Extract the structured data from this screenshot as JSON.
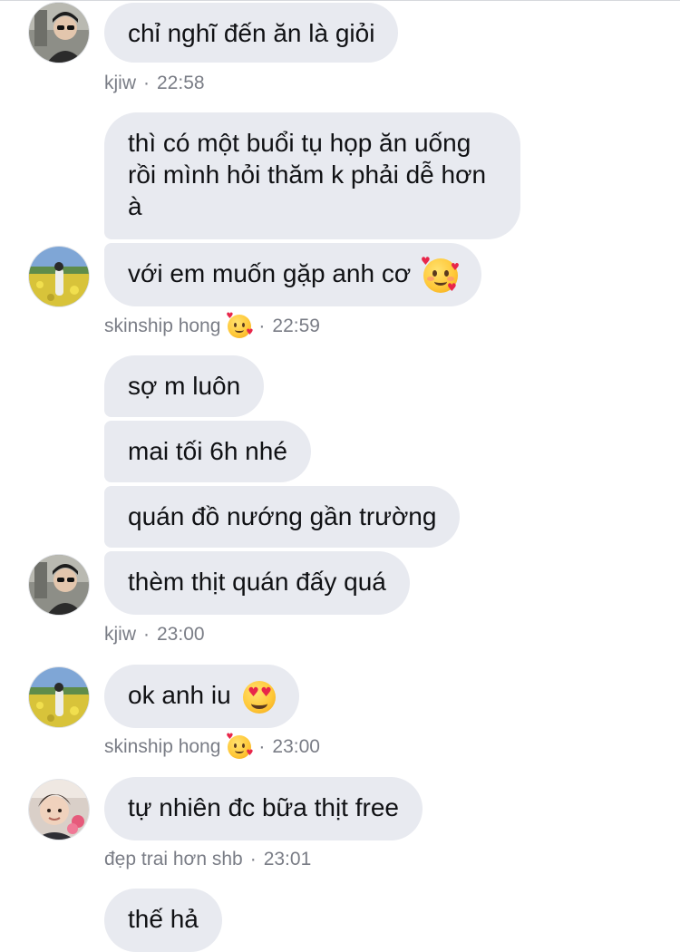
{
  "users": {
    "kjiw": "kjiw",
    "skinship": "skinship hong",
    "deptrai": "đẹp trai hơn shb"
  },
  "icons": {
    "smiling_hearts": "smiling-face-with-hearts-emoji",
    "heart_eyes": "heart-eyes-emoji"
  },
  "messages": {
    "m1": "chỉ nghĩ đến ăn là giỏi",
    "m2": "thì có một buổi tụ họp ăn uống rồi mình hỏi thăm k phải dễ hơn à",
    "m3": "với em muốn gặp anh cơ",
    "m4": "sợ m luôn",
    "m5": "mai tối 6h nhé",
    "m6": "quán đồ nướng gần trường",
    "m7": "thèm thịt quán đấy quá",
    "m8": "ok anh iu",
    "m9": "tự nhiên đc bữa thịt free",
    "m10": "thế hả"
  },
  "meta": {
    "g1": {
      "sep": "·",
      "time": "22:58"
    },
    "g2": {
      "sep": "·",
      "time": "22:59"
    },
    "g3": {
      "sep": "·",
      "time": "23:00"
    },
    "g4": {
      "sep": "·",
      "time": "23:00"
    },
    "g5": {
      "sep": "·",
      "time": "23:01"
    }
  },
  "colors": {
    "bubble": "#e8eaf0",
    "meta_text": "#7a7d86",
    "message_text": "#101114"
  }
}
